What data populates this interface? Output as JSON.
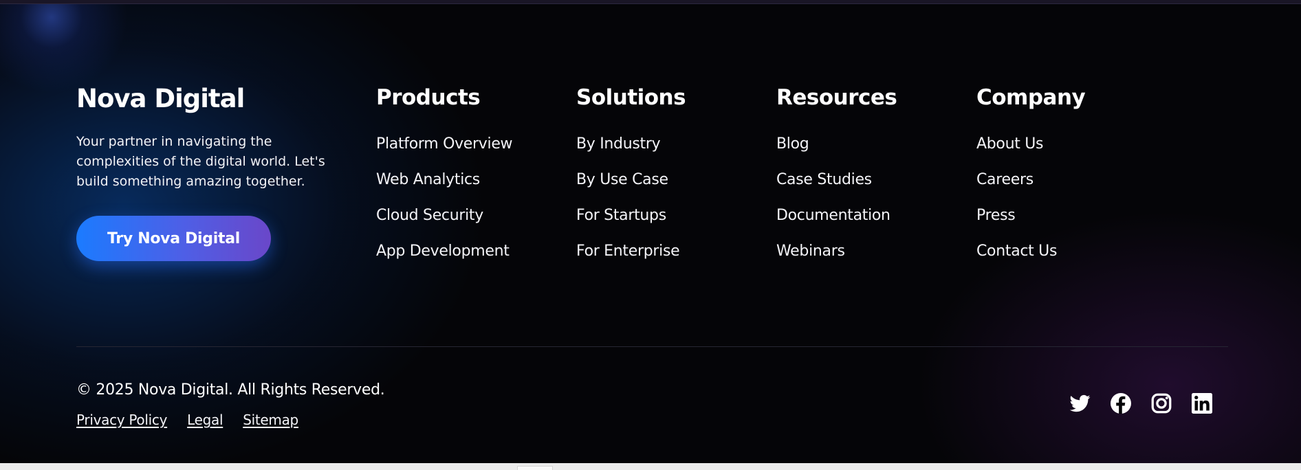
{
  "brand": {
    "name": "Nova Digital",
    "tagline": "Your partner in navigating the complexities of the digital world. Let's build something amazing together.",
    "cta_label": "Try Nova Digital"
  },
  "columns": [
    {
      "title": "Products",
      "links": [
        "Platform Overview",
        "Web Analytics",
        "Cloud Security",
        "App Development"
      ]
    },
    {
      "title": "Solutions",
      "links": [
        "By Industry",
        "By Use Case",
        "For Startups",
        "For Enterprise"
      ]
    },
    {
      "title": "Resources",
      "links": [
        "Blog",
        "Case Studies",
        "Documentation",
        "Webinars"
      ]
    },
    {
      "title": "Company",
      "links": [
        "About Us",
        "Careers",
        "Press",
        "Contact Us"
      ]
    }
  ],
  "bottom": {
    "copyright": "© 2025 Nova Digital. All Rights Reserved.",
    "legal_links": [
      "Privacy Policy",
      "Legal",
      "Sitemap"
    ]
  },
  "social": [
    "twitter-icon",
    "facebook-icon",
    "instagram-icon",
    "linkedin-icon"
  ],
  "colors": {
    "background": "#050508",
    "cta_gradient_start": "#1b7bff",
    "cta_gradient_end": "#6a47c9",
    "text": "#ffffff"
  }
}
